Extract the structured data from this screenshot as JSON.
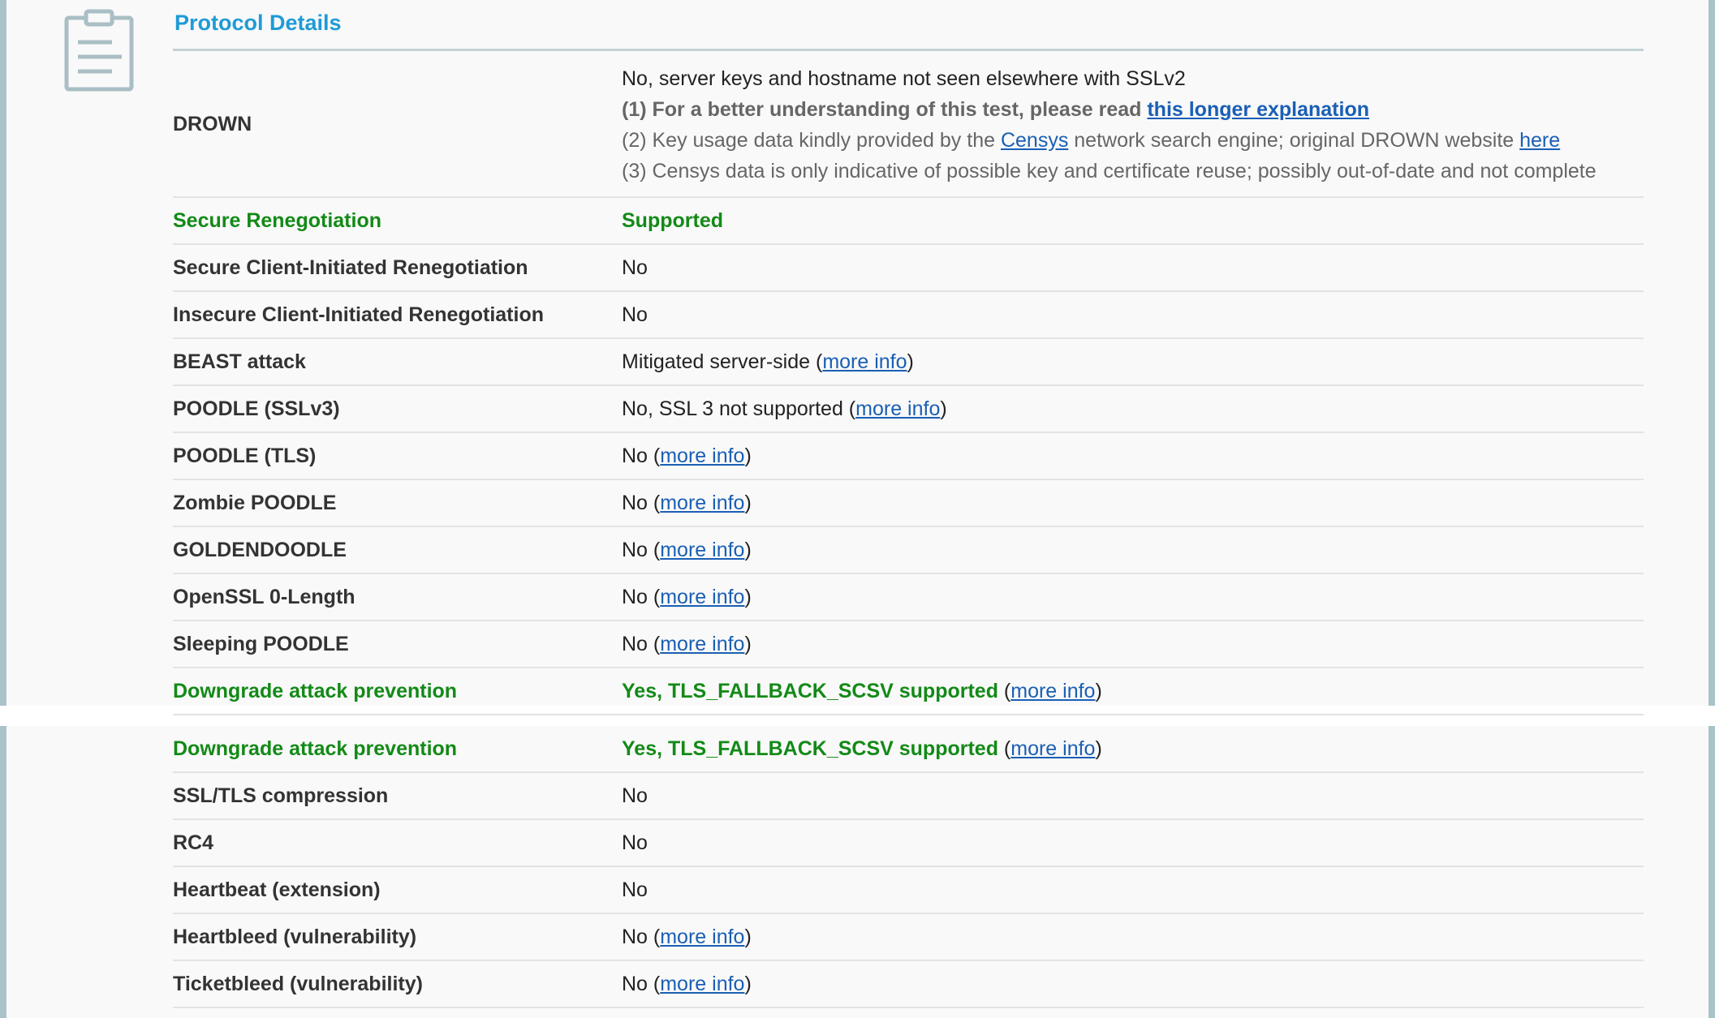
{
  "section": {
    "title": "Protocol Details",
    "icon": "clipboard-icon",
    "colors": {
      "title": "#1e9bd7",
      "good": "#138a17",
      "link": "#1a5fb4",
      "border": "#a9c3c9"
    }
  },
  "drown": {
    "label": "DROWN",
    "value": "No, server keys and hostname not seen elsewhere with SSLv2",
    "note1_prefix": "(1) For a better understanding of this test, please read ",
    "note1_link": "this longer explanation",
    "note2_prefix": "(2) Key usage data kindly provided by the ",
    "note2_link1": "Censys",
    "note2_middle": " network search engine; original DROWN website ",
    "note2_link2": "here",
    "note3": "(3) Censys data is only indicative of possible key and certificate reuse; possibly out-of-date and not complete"
  },
  "more_info": "more info",
  "top_rows": [
    {
      "label": "Secure Renegotiation",
      "value": "Supported"
    },
    {
      "label": "Secure Client-Initiated Renegotiation",
      "value": "No"
    },
    {
      "label": "Insecure Client-Initiated Renegotiation",
      "value": "No"
    },
    {
      "label": "BEAST attack",
      "value": "Mitigated server-side ("
    },
    {
      "label": "POODLE (SSLv3)",
      "value": "No, SSL 3 not supported ("
    },
    {
      "label": "POODLE (TLS)",
      "value": "No ("
    },
    {
      "label": "Zombie POODLE",
      "value": "No ("
    },
    {
      "label": "GOLDENDOODLE",
      "value": "No ("
    },
    {
      "label": "OpenSSL 0-Length",
      "value": "No ("
    },
    {
      "label": "Sleeping POODLE",
      "value": "No ("
    },
    {
      "label": "Downgrade attack prevention",
      "value": "Yes, TLS_FALLBACK_SCSV supported"
    }
  ],
  "bottom_rows": [
    {
      "label": "Downgrade attack prevention",
      "value": "Yes, TLS_FALLBACK_SCSV supported"
    },
    {
      "label": "SSL/TLS compression",
      "value": "No"
    },
    {
      "label": "RC4",
      "value": "No"
    },
    {
      "label": "Heartbeat (extension)",
      "value": "No"
    },
    {
      "label": "Heartbleed (vulnerability)",
      "value": "No ("
    },
    {
      "label": "Ticketbleed (vulnerability)",
      "value": "No ("
    }
  ],
  "punct": {
    "close_paren": ")",
    "space_open_paren": " ("
  }
}
